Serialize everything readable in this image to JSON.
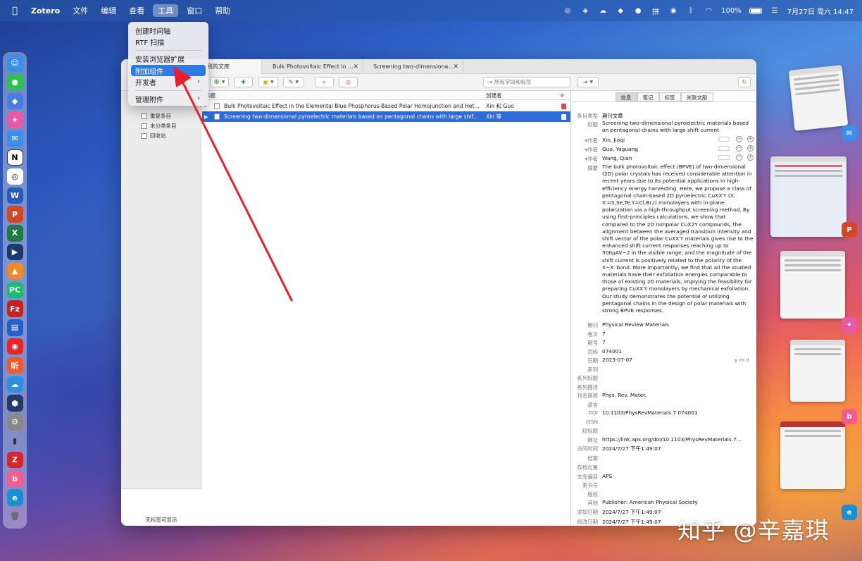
{
  "menubar": {
    "app_name": "Zotero",
    "menus": [
      "文件",
      "编辑",
      "查看",
      "工具",
      "窗口",
      "帮助"
    ],
    "active_menu": "工具",
    "battery": "100%",
    "datetime": "7月27日 周六 14:47"
  },
  "dropdown": {
    "items": [
      "创建时间轴",
      "RTF 扫描",
      "安装浏览器扩展",
      "附加组件",
      "开发者",
      "管理附件"
    ],
    "highlighted": "附加组件"
  },
  "tabs": {
    "library": "我的文库",
    "tab2": "Bulk Photovoltaic Effect in ...",
    "tab3": "Screening two-dimensiona..."
  },
  "toolbar": {
    "search_placeholder": "所有字段和标签"
  },
  "collections": {
    "items": [
      "重复条目",
      "未分类条目",
      "回收站"
    ],
    "tags_empty": "无标签可显示"
  },
  "itemlist": {
    "col_title": "标题",
    "col_creator": "创建者",
    "rows": [
      {
        "title": "Bulk Photovoltaic Effect in the Elemental Blue Phosphorus-Based Polar Homojunction and Het...",
        "creator": "Xin 和 Guo"
      },
      {
        "title": "Screening two-dimensional pyroelectric materials based on pentagonal chains with large shif...",
        "creator": "Xin 等"
      }
    ]
  },
  "infopane": {
    "tabs": [
      "信息",
      "笔记",
      "标签",
      "关联文献"
    ],
    "fields": {
      "item_type_label": "条目类型",
      "item_type": "期刊文章",
      "title_label": "标题",
      "title": "Screening two-dimensional pyroelectric materials based on pentagonal chains with large shift current",
      "author_label": "作者",
      "authors": [
        "Xin, Jiaqi",
        "Guo, Yaguang",
        "Wang, Qian"
      ],
      "abstract_label": "摘要",
      "abstract": "The bulk photovoltaic effect (BPVE) of two-dimensional (2D) polar crystals has received considerable attention in recent years due to its potential applications in high-efficiency energy harvesting. Here, we propose a class of pentagonal chain-based 2D pyroelectric CuXX′Y (X, X′=S,Se,Te;Y=Cl,Br,I) monolayers with in-plane polarization via a high-throughput screening method. By using first-principles calculations, we show that compared to the 2D nonpolar CuX2Y compounds, the alignment between the averaged transition intensity and shift vector of the polar CuXX′Y materials gives rise to the enhanced shift current responses reaching up to 500μAV−2 in the visible range, and the magnitude of the shift current is positively related to the polarity of the X−X′ bond. More importantly, we find that all the studied materials have their exfoliation energies comparable to those of existing 2D materials, implying the feasibility for preparing CuXX′Y monolayers by mechanical exfoliation. Our study demonstrates the potential of utilizing pentagonal chains in the design of polar materials with strong BPVE responses.",
      "publication_label": "期刊",
      "publication": "Physical Review Materials",
      "volume_label": "卷次",
      "volume": "7",
      "issue_label": "期号",
      "issue": "7",
      "pages_label": "页码",
      "pages": "074001",
      "date_label": "日期",
      "date": "2023-07-07",
      "date_hint": "y m d",
      "series_label": "系列",
      "series_title_label": "系列标题",
      "series_text_label": "系列描述",
      "journal_abbr_label": "刊名简称",
      "journal_abbr": "Phys. Rev. Mater.",
      "language_label": "语言",
      "doi_label": "DOI",
      "doi": "10.1103/PhysRevMaterials.7.074001",
      "issn_label": "ISSN",
      "short_title_label": "短标题",
      "url_label": "网址",
      "url": "https://link.aps.org/doi/10.1103/PhysRevMaterials.7...",
      "accessed_label": "访问时间",
      "accessed": "2024/7/27 下午1:49:07",
      "archive_label": "档案",
      "loc_label": "存档位置",
      "library_catalog_label": "文库编目",
      "library_catalog": "APS",
      "call_number_label": "索书号",
      "rights_label": "版权",
      "extra_label": "其他",
      "extra": "Publisher: American Physical Society",
      "added_label": "添加日期",
      "added": "2024/7/27 下午1:49:07",
      "modified_label": "修改日期",
      "modified": "2024/7/27 下午1:49:07"
    }
  },
  "watermark": "知乎 @辛嘉琪",
  "colors": {
    "accent": "#2f6bd6",
    "arrow": "#e8202a"
  }
}
